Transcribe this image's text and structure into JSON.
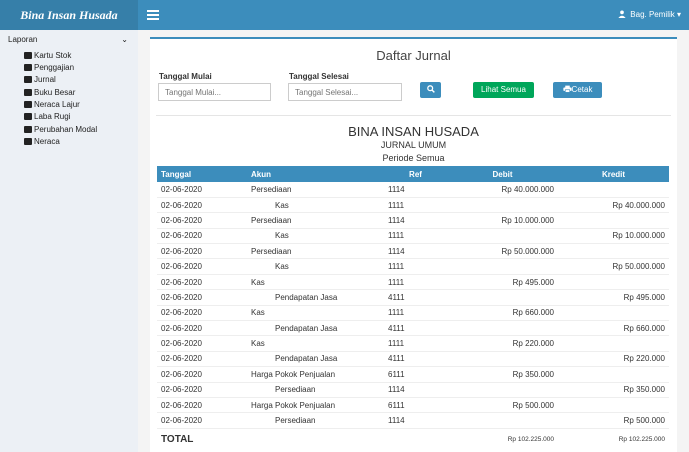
{
  "app": {
    "brand": "Bina Insan Husada",
    "user_label": "Bag. Pemilik"
  },
  "sidebar": {
    "section_label": "Laporan",
    "items": [
      {
        "label": "Kartu Stok"
      },
      {
        "label": "Penggajian"
      },
      {
        "label": "Jurnal"
      },
      {
        "label": "Buku Besar"
      },
      {
        "label": "Neraca Lajur"
      },
      {
        "label": "Laba Rugi"
      },
      {
        "label": "Perubahan Modal"
      },
      {
        "label": "Neraca"
      }
    ]
  },
  "page": {
    "title": "Daftar Jurnal"
  },
  "filters": {
    "start_label": "Tanggal Mulai",
    "start_placeholder": "Tanggal Mulai...",
    "end_label": "Tanggal Selesai",
    "end_placeholder": "Tanggal Selesai...",
    "show_all_label": "Lihat Semua",
    "print_label": "Cetak"
  },
  "report": {
    "company": "BINA INSAN HUSADA",
    "name": "JURNAL UMUM",
    "period": "Periode Semua"
  },
  "table": {
    "headers": {
      "date": "Tanggal",
      "account": "Akun",
      "ref": "Ref",
      "debit": "Debit",
      "credit": "Kredit"
    },
    "rows": [
      {
        "date": "02-06-2020",
        "account": "Persediaan",
        "ref": "1114",
        "debit": "Rp 40.000.000",
        "credit": ""
      },
      {
        "date": "02-06-2020",
        "account": "Kas",
        "ref": "1111",
        "debit": "",
        "credit": "Rp 40.000.000"
      },
      {
        "date": "02-06-2020",
        "account": "Persediaan",
        "ref": "1114",
        "debit": "Rp 10.000.000",
        "credit": ""
      },
      {
        "date": "02-06-2020",
        "account": "Kas",
        "ref": "1111",
        "debit": "",
        "credit": "Rp 10.000.000"
      },
      {
        "date": "02-06-2020",
        "account": "Persediaan",
        "ref": "1114",
        "debit": "Rp 50.000.000",
        "credit": ""
      },
      {
        "date": "02-06-2020",
        "account": "Kas",
        "ref": "1111",
        "debit": "",
        "credit": "Rp 50.000.000"
      },
      {
        "date": "02-06-2020",
        "account": "Kas",
        "ref": "1111",
        "debit": "Rp 495.000",
        "credit": ""
      },
      {
        "date": "02-06-2020",
        "account": "Pendapatan Jasa",
        "ref": "4111",
        "debit": "",
        "credit": "Rp 495.000"
      },
      {
        "date": "02-06-2020",
        "account": "Kas",
        "ref": "1111",
        "debit": "Rp 660.000",
        "credit": ""
      },
      {
        "date": "02-06-2020",
        "account": "Pendapatan Jasa",
        "ref": "4111",
        "debit": "",
        "credit": "Rp 660.000"
      },
      {
        "date": "02-06-2020",
        "account": "Kas",
        "ref": "1111",
        "debit": "Rp 220.000",
        "credit": ""
      },
      {
        "date": "02-06-2020",
        "account": "Pendapatan Jasa",
        "ref": "4111",
        "debit": "",
        "credit": "Rp 220.000"
      },
      {
        "date": "02-06-2020",
        "account": "Harga Pokok Penjualan",
        "ref": "6111",
        "debit": "Rp 350.000",
        "credit": ""
      },
      {
        "date": "02-06-2020",
        "account": "Persediaan",
        "ref": "1114",
        "debit": "",
        "credit": "Rp 350.000"
      },
      {
        "date": "02-06-2020",
        "account": "Harga Pokok Penjualan",
        "ref": "6111",
        "debit": "Rp 500.000",
        "credit": ""
      },
      {
        "date": "02-06-2020",
        "account": "Persediaan",
        "ref": "1114",
        "debit": "",
        "credit": "Rp 500.000"
      }
    ],
    "total_label": "TOTAL",
    "total_debit": "Rp 102.225.000",
    "total_credit": "Rp 102.225.000"
  },
  "colors": {
    "primary": "#3c8dbc",
    "brand_bg": "#367fa9",
    "success": "#00a65a",
    "sidebar_bg": "#ecf0f5"
  }
}
